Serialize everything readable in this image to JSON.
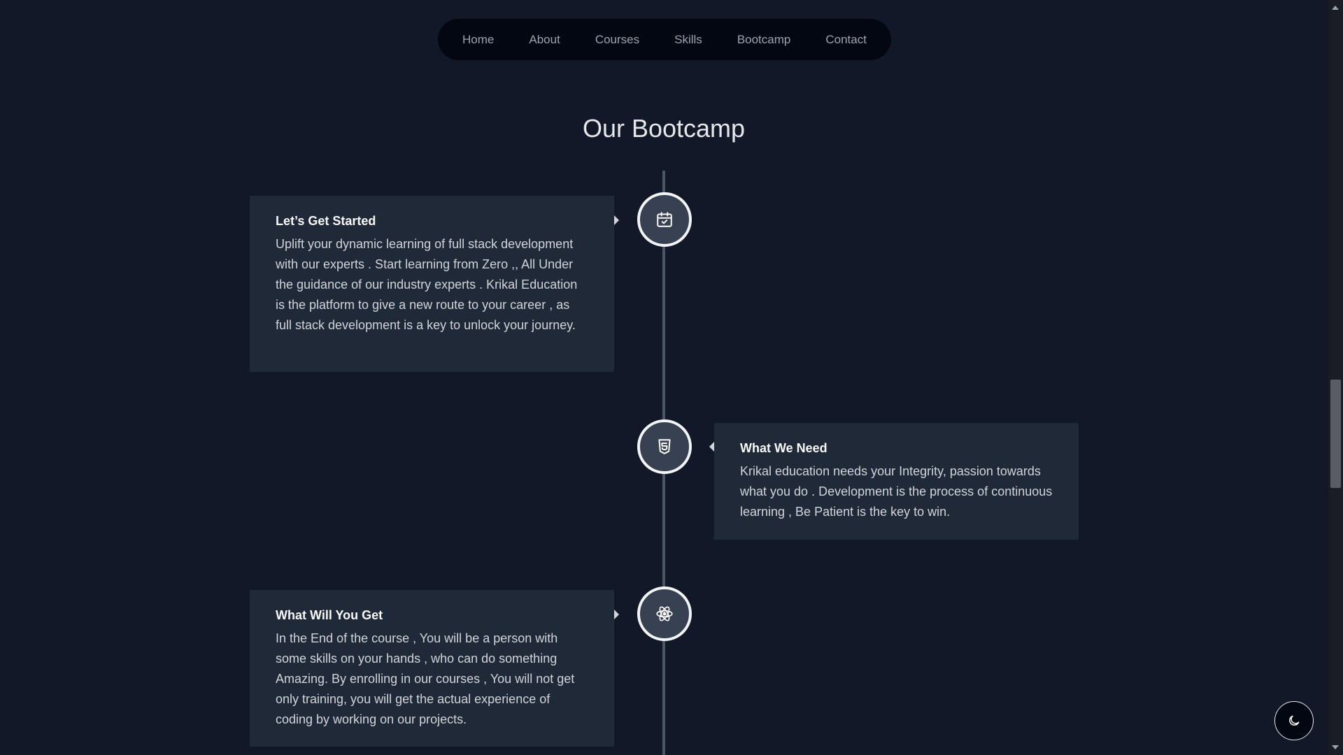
{
  "nav": {
    "items": [
      "Home",
      "About",
      "Courses",
      "Skills",
      "Bootcamp",
      "Contact"
    ]
  },
  "section": {
    "title": "Our Bootcamp"
  },
  "timeline": [
    {
      "side": "left",
      "icon": "calendar-check-icon",
      "title": "Let’s Get Started",
      "text": "Uplift your dynamic learning of full stack development with our experts . Start learning from Zero ,, All Under the guidance of our industry experts . Krikal Education is the platform to give a new route to your career , as full stack development is a key to unlock your journey."
    },
    {
      "side": "right",
      "icon": "html5-icon",
      "title": "What We Need",
      "text": "Krikal education needs your Integrity, passion towards what you do . Development is the process of continuous learning , Be Patient is the key to win."
    },
    {
      "side": "left",
      "icon": "react-atom-icon",
      "title": "What Will You Get",
      "text": "In the End of the course , You will be a person with some skills on your hands , who can do something Amazing. By enrolling in our courses , You will not get only training, you will get the actual experience of coding by working on our projects."
    }
  ],
  "theme_toggle": {
    "icon": "moon-icon"
  },
  "colors": {
    "background": "#111827",
    "card": "#1f2937",
    "nav_bg": "#030712",
    "timeline_line": "#4b5563"
  }
}
